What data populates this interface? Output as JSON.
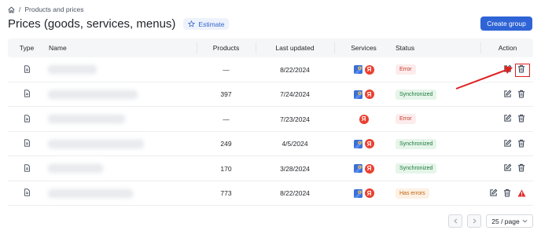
{
  "breadcrumb": {
    "home_icon": "home-icon",
    "separator": "/",
    "current": "Products and prices"
  },
  "header": {
    "title": "Prices (goods, services, menus)",
    "estimate_label": "Estimate",
    "create_group_label": "Create group"
  },
  "table": {
    "columns": {
      "type": "Type",
      "name": "Name",
      "products": "Products",
      "last_updated": "Last updated",
      "services": "Services",
      "status": "Status",
      "action": "Action"
    },
    "rows": [
      {
        "name": "",
        "products": "—",
        "last_updated": "8/22/2024",
        "services": [
          "google-maps",
          "yandex"
        ],
        "status": "Error",
        "status_kind": "error",
        "actions": [
          "edit",
          "delete"
        ]
      },
      {
        "name": "",
        "products": "397",
        "last_updated": "7/24/2024",
        "services": [
          "google-maps",
          "yandex"
        ],
        "status": "Synchronized",
        "status_kind": "sync",
        "actions": [
          "edit",
          "delete"
        ]
      },
      {
        "name": "",
        "products": "—",
        "last_updated": "7/23/2024",
        "services": [
          "yandex"
        ],
        "status": "Error",
        "status_kind": "error",
        "actions": [
          "edit",
          "delete"
        ]
      },
      {
        "name": "",
        "products": "249",
        "last_updated": "4/5/2024",
        "services": [
          "google-maps",
          "yandex"
        ],
        "status": "Synchronized",
        "status_kind": "sync",
        "actions": [
          "edit",
          "delete"
        ]
      },
      {
        "name": "",
        "products": "170",
        "last_updated": "3/28/2024",
        "services": [
          "google-maps",
          "yandex"
        ],
        "status": "Synchronized",
        "status_kind": "sync",
        "actions": [
          "edit",
          "delete"
        ]
      },
      {
        "name": "",
        "products": "773",
        "last_updated": "8/22/2024",
        "services": [
          "google-maps",
          "yandex"
        ],
        "status": "Has errors",
        "status_kind": "warn",
        "actions": [
          "edit",
          "delete",
          "warning"
        ]
      }
    ]
  },
  "services": {
    "yandex_letter": "Я"
  },
  "pagination": {
    "page_size_label": "25 / page"
  },
  "colors": {
    "primary": "#2f64d6",
    "error": "#c0392b",
    "success": "#1e7b3d",
    "warning": "#c2610f",
    "annotation": "#e02020"
  }
}
